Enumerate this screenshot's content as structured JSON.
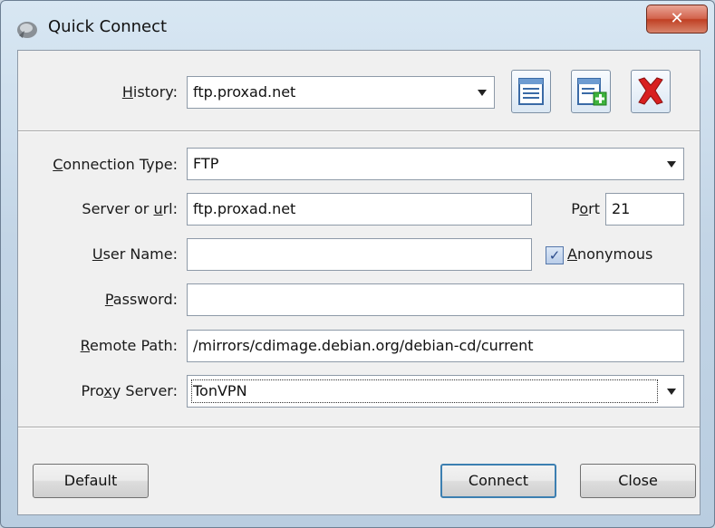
{
  "window": {
    "title": "Quick Connect",
    "close_glyph": "✕"
  },
  "history": {
    "label_prefix": "",
    "label_u": "H",
    "label_rest": "istory:",
    "value": "ftp.proxad.net"
  },
  "toolbar": {
    "icons": [
      "list-icon",
      "add-list-icon",
      "delete-icon"
    ]
  },
  "connection_type": {
    "label_u": "C",
    "label_rest": "onnection Type:",
    "value": "FTP"
  },
  "server": {
    "label_pre": "Server or ",
    "label_u": "u",
    "label_rest": "rl:",
    "value": "ftp.proxad.net"
  },
  "port": {
    "label_pre": "P",
    "label_u": "o",
    "label_rest": "rt",
    "value": "21"
  },
  "user": {
    "label_u": "U",
    "label_rest": "ser Name:",
    "value": ""
  },
  "anonymous": {
    "label_u": "A",
    "label_rest": "nonymous",
    "checked": true
  },
  "password": {
    "label_u": "P",
    "label_rest": "assword:",
    "value": ""
  },
  "remote_path": {
    "label_u": "R",
    "label_rest": "emote Path:",
    "value": "/mirrors/cdimage.debian.org/debian-cd/current"
  },
  "proxy": {
    "label_pre": "Pro",
    "label_u": "x",
    "label_rest": "y Server:",
    "value": "TonVPN"
  },
  "buttons": {
    "default": "Default",
    "connect": "Connect",
    "close": "Close"
  }
}
